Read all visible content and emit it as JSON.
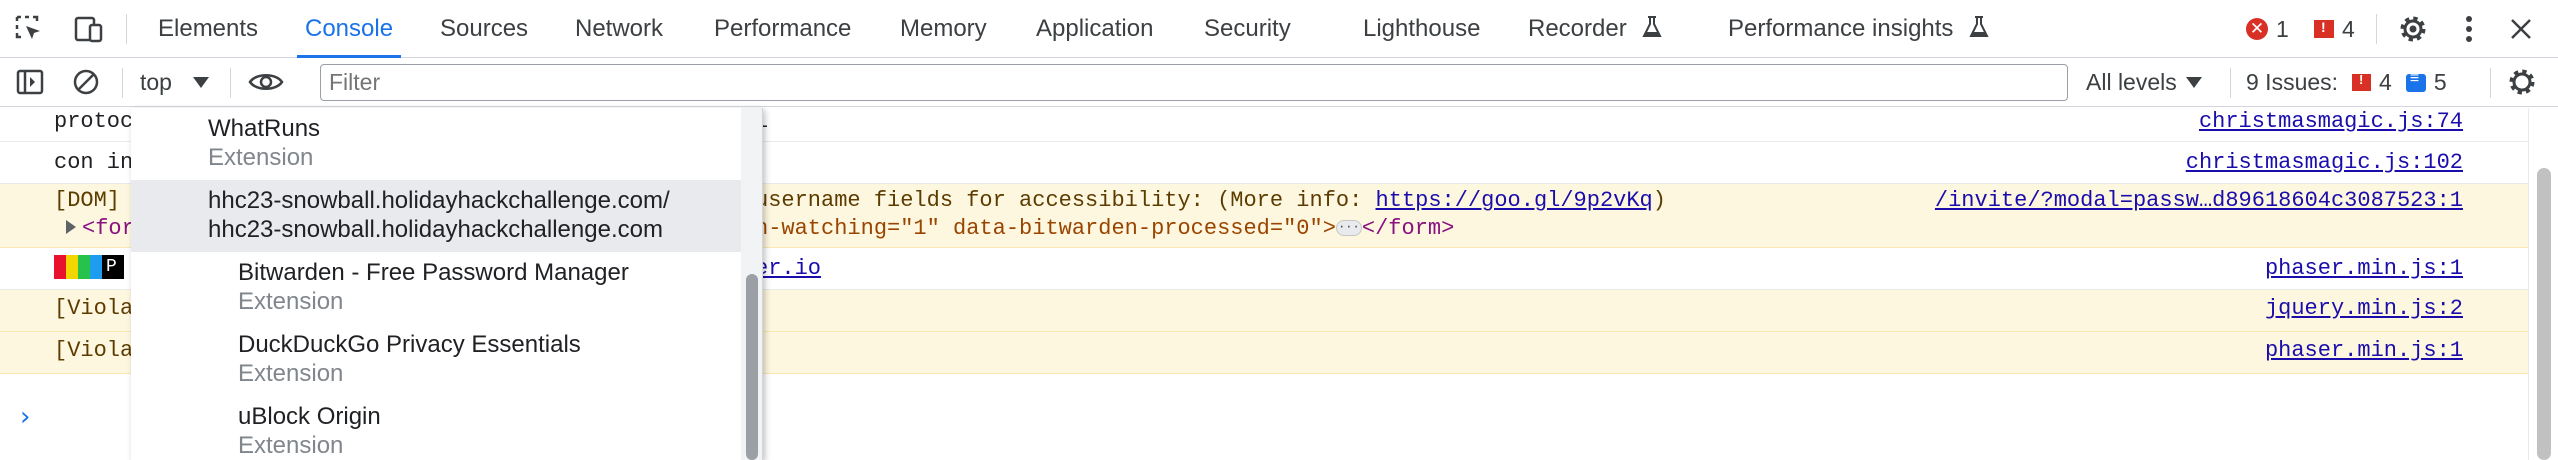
{
  "tabbar": {
    "tabs": [
      {
        "label": "Elements"
      },
      {
        "label": "Console"
      },
      {
        "label": "Sources"
      },
      {
        "label": "Network"
      },
      {
        "label": "Performance"
      },
      {
        "label": "Memory"
      },
      {
        "label": "Application"
      },
      {
        "label": "Security"
      },
      {
        "label": "Lighthouse"
      },
      {
        "label": "Recorder"
      },
      {
        "label": "Performance insights"
      }
    ],
    "active_tab": "Console",
    "error_count": "1",
    "issue_count": "4",
    "icons": [
      "inspect-element-icon",
      "device-toolbar-icon",
      "flask-icon",
      "settings-gear-icon",
      "more-vert-icon",
      "close-icon"
    ]
  },
  "toolbar": {
    "context_label": "top",
    "filter_placeholder": "Filter",
    "levels_label": "All levels",
    "issues_label": "9 Issues:",
    "issues_errors": "4",
    "issues_info": "5",
    "icons": [
      "show-sidebar-icon",
      "clear-console-icon",
      "eye-icon",
      "console-settings-icon"
    ]
  },
  "console": {
    "messages": [
      {
        "text": "protoc",
        "text2": "l",
        "source": "christmasmagic.js:74",
        "level": "info"
      },
      {
        "text": "con in",
        "text2": "",
        "source": "christmasmagic.js:102",
        "level": "info"
      },
      {
        "text": "[DOM]",
        "text2": "username fields for accessibility: (More info: ",
        "link": "https://goo.gl/9p2vKq",
        "text2_end": ")",
        "source": "/invite/?modal=passw…d89618604c3087523:1",
        "level": "warning"
      },
      {
        "text": "<for",
        "text2": "n-watching=\"1\" data-bitwarden-processed=\"0\">",
        "text2_end": "</form>",
        "level": "warning"
      },
      {
        "text": "P",
        "text2_link": "er.io",
        "source": "phaser.min.js:1",
        "level": "info"
      },
      {
        "text": "[Viola",
        "source": "jquery.min.js:2",
        "level": "warning"
      },
      {
        "text": "[Viola",
        "source": "phaser.min.js:1",
        "level": "warning"
      }
    ],
    "prompt_symbol": "›"
  },
  "context_dropdown": {
    "items": [
      {
        "title": "WhatRuns",
        "subtitle": "Extension",
        "indent": false,
        "selected": false
      },
      {
        "title": "hhc23-snowball.holidayhackchallenge.com/",
        "subtitle": "hhc23-snowball.holidayhackchallenge.com",
        "indent": false,
        "selected": true
      },
      {
        "title": "Bitwarden - Free Password Manager",
        "subtitle": "Extension",
        "indent": true,
        "selected": false
      },
      {
        "title": "DuckDuckGo Privacy Essentials",
        "subtitle": "Extension",
        "indent": true,
        "selected": false
      },
      {
        "title": "uBlock Origin",
        "subtitle": "Extension",
        "indent": true,
        "selected": false
      }
    ]
  },
  "colors": {
    "accent": "#1a73e8",
    "error": "#d93025",
    "warning_bg": "#fef7e0",
    "link": "#1a0dab"
  }
}
